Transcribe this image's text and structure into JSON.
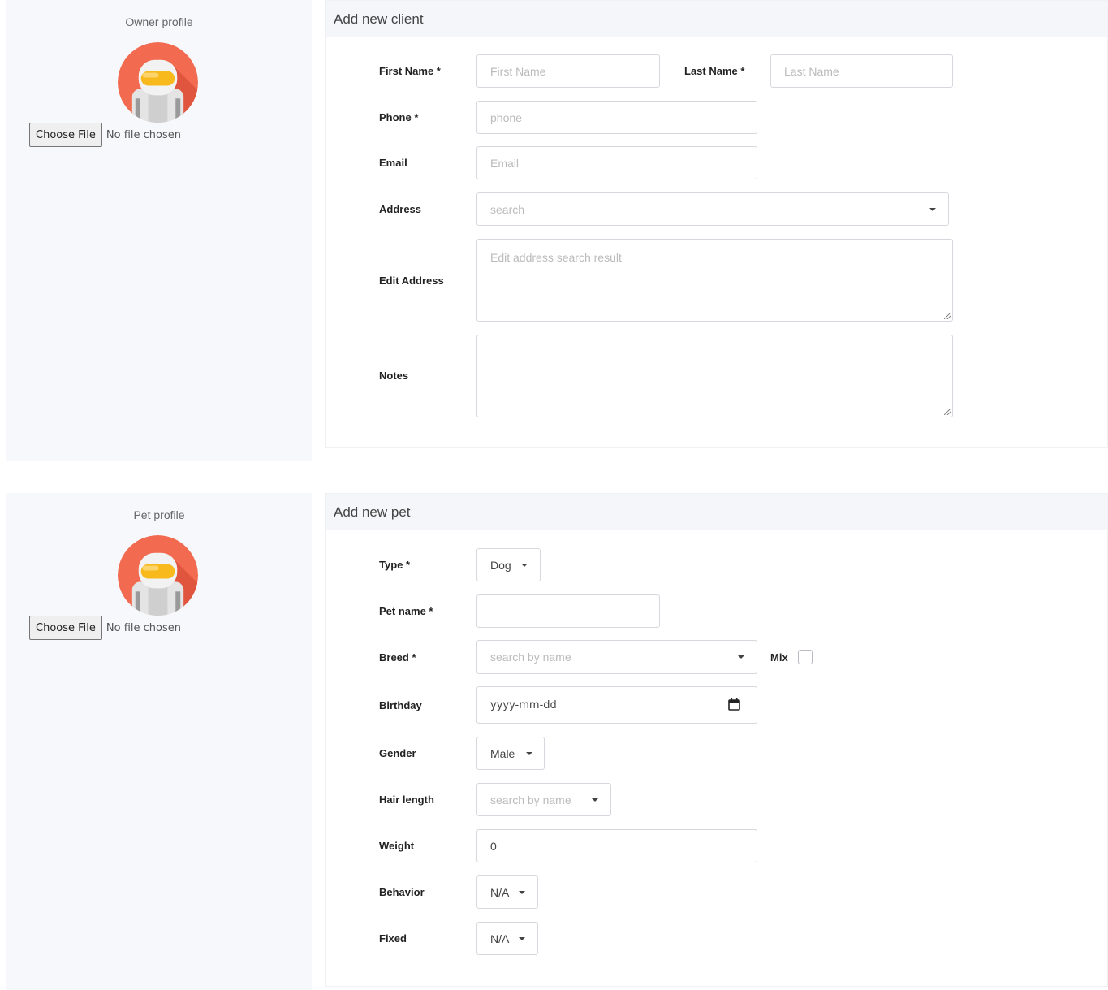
{
  "owner": {
    "profile_label": "Owner profile",
    "choose_file": "Choose File",
    "no_file": "No file chosen"
  },
  "client_form": {
    "title": "Add new client",
    "first_name_label": "First Name *",
    "first_name_placeholder": "First Name",
    "last_name_label": "Last Name *",
    "last_name_placeholder": "Last Name",
    "phone_label": "Phone *",
    "phone_placeholder": "phone",
    "email_label": "Email",
    "email_placeholder": "Email",
    "address_label": "Address",
    "address_placeholder": "search",
    "edit_address_label": "Edit Address",
    "edit_address_placeholder": "Edit address search result",
    "notes_label": "Notes"
  },
  "pet": {
    "profile_label": "Pet profile",
    "choose_file": "Choose File",
    "no_file": "No file chosen"
  },
  "pet_form": {
    "title": "Add new pet",
    "type_label": "Type *",
    "type_value": "Dog",
    "pet_name_label": "Pet name *",
    "breed_label": "Breed *",
    "breed_placeholder": "search by name",
    "mix_label": "Mix",
    "birthday_label": "Birthday",
    "birthday_placeholder": "yyyy-mm-dd",
    "gender_label": "Gender",
    "gender_value": "Male",
    "hair_length_label": "Hair length",
    "hair_length_placeholder": "search by name",
    "weight_label": "Weight",
    "weight_value": "0",
    "behavior_label": "Behavior",
    "behavior_value": "N/A",
    "fixed_label": "Fixed",
    "fixed_value": "N/A"
  },
  "colors": {
    "avatar_bg": "#f26b50",
    "visor": "#f7b91c",
    "panel_head": "#f5f6fa",
    "sidebar_bg": "#f7f8fc"
  }
}
